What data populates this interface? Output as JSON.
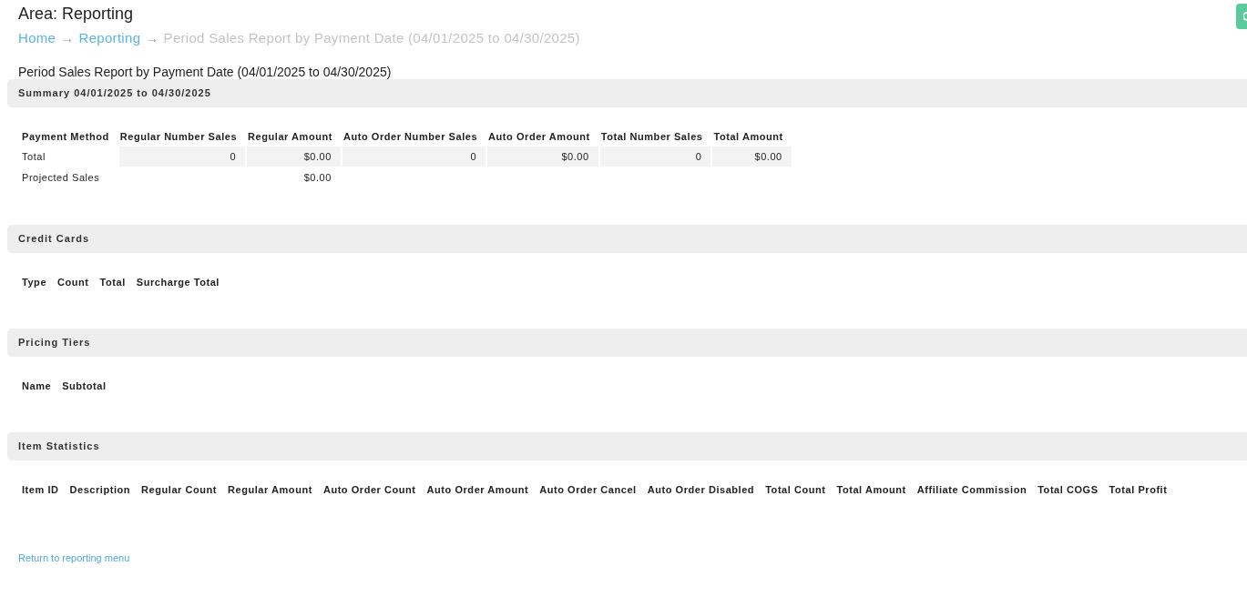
{
  "area_title": "Area: Reporting",
  "breadcrumb": [
    {
      "label": "Home",
      "kind": "link",
      "separator": "→"
    },
    {
      "label": "Reporting",
      "kind": "link",
      "separator": "→"
    },
    {
      "label": "Period Sales Report by Payment Date (04/01/2025 to 04/30/2025)",
      "kind": "current"
    }
  ],
  "report_title": "Period Sales Report by Payment Date (04/01/2025 to 04/30/2025)",
  "sections": [
    {
      "title": "Summary 04/01/2025 to 04/30/2025",
      "columns": [
        "Payment Method",
        "Regular Number Sales",
        "Regular Amount",
        "Auto Order Number Sales",
        "Auto Order Amount",
        "Total Number Sales",
        "Total Amount"
      ],
      "rows": [
        {
          "shaded": true,
          "cells": [
            "Total",
            "0",
            "$0.00",
            "0",
            "$0.00",
            "0",
            "$0.00"
          ]
        },
        {
          "shaded": false,
          "cells": [
            "Projected Sales",
            null,
            "$0.00",
            null,
            null,
            null,
            null
          ]
        }
      ]
    },
    {
      "title": "Credit Cards",
      "columns": [
        "Type",
        "Count",
        "Total",
        "Surcharge Total"
      ]
    },
    {
      "title": "Pricing Tiers",
      "columns": [
        "Name",
        "Subtotal"
      ]
    },
    {
      "title": "Item Statistics",
      "columns": [
        "Item ID",
        "Description",
        "Regular Count",
        "Regular Amount",
        "Auto Order Count",
        "Auto Order Amount",
        "Auto Order Cancel",
        "Auto Order Disabled",
        "Total Count",
        "Total Amount",
        "Affiliate Commission",
        "Total COGS",
        "Total Profit"
      ]
    }
  ],
  "footer_link": "Return to reporting menu"
}
